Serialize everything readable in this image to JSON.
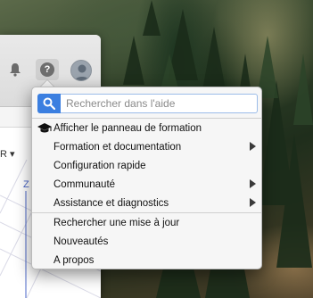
{
  "toolbar": {
    "bell_icon": "bell-icon",
    "help_icon": "help-icon",
    "help_glyph": "?",
    "avatar_icon": "user-avatar-icon"
  },
  "app": {
    "r_label": "R ▾",
    "z_label": "Z"
  },
  "help_menu": {
    "search_placeholder": "Rechercher dans l'aide",
    "items": [
      {
        "label": "Afficher le panneau de formation",
        "icon": "graduation-cap-icon",
        "submenu": false
      },
      {
        "label": "Formation et documentation",
        "submenu": true
      },
      {
        "label": "Configuration rapide",
        "submenu": false
      },
      {
        "label": "Communauté",
        "submenu": true
      },
      {
        "label": "Assistance et diagnostics",
        "submenu": true
      },
      {
        "label": "Rechercher une mise à jour",
        "submenu": false
      },
      {
        "label": "Nouveautés",
        "submenu": false
      },
      {
        "label": "A propos",
        "submenu": false
      }
    ]
  },
  "colors": {
    "accent": "#3b7fe0",
    "menu_bg": "#f6f6f6"
  }
}
